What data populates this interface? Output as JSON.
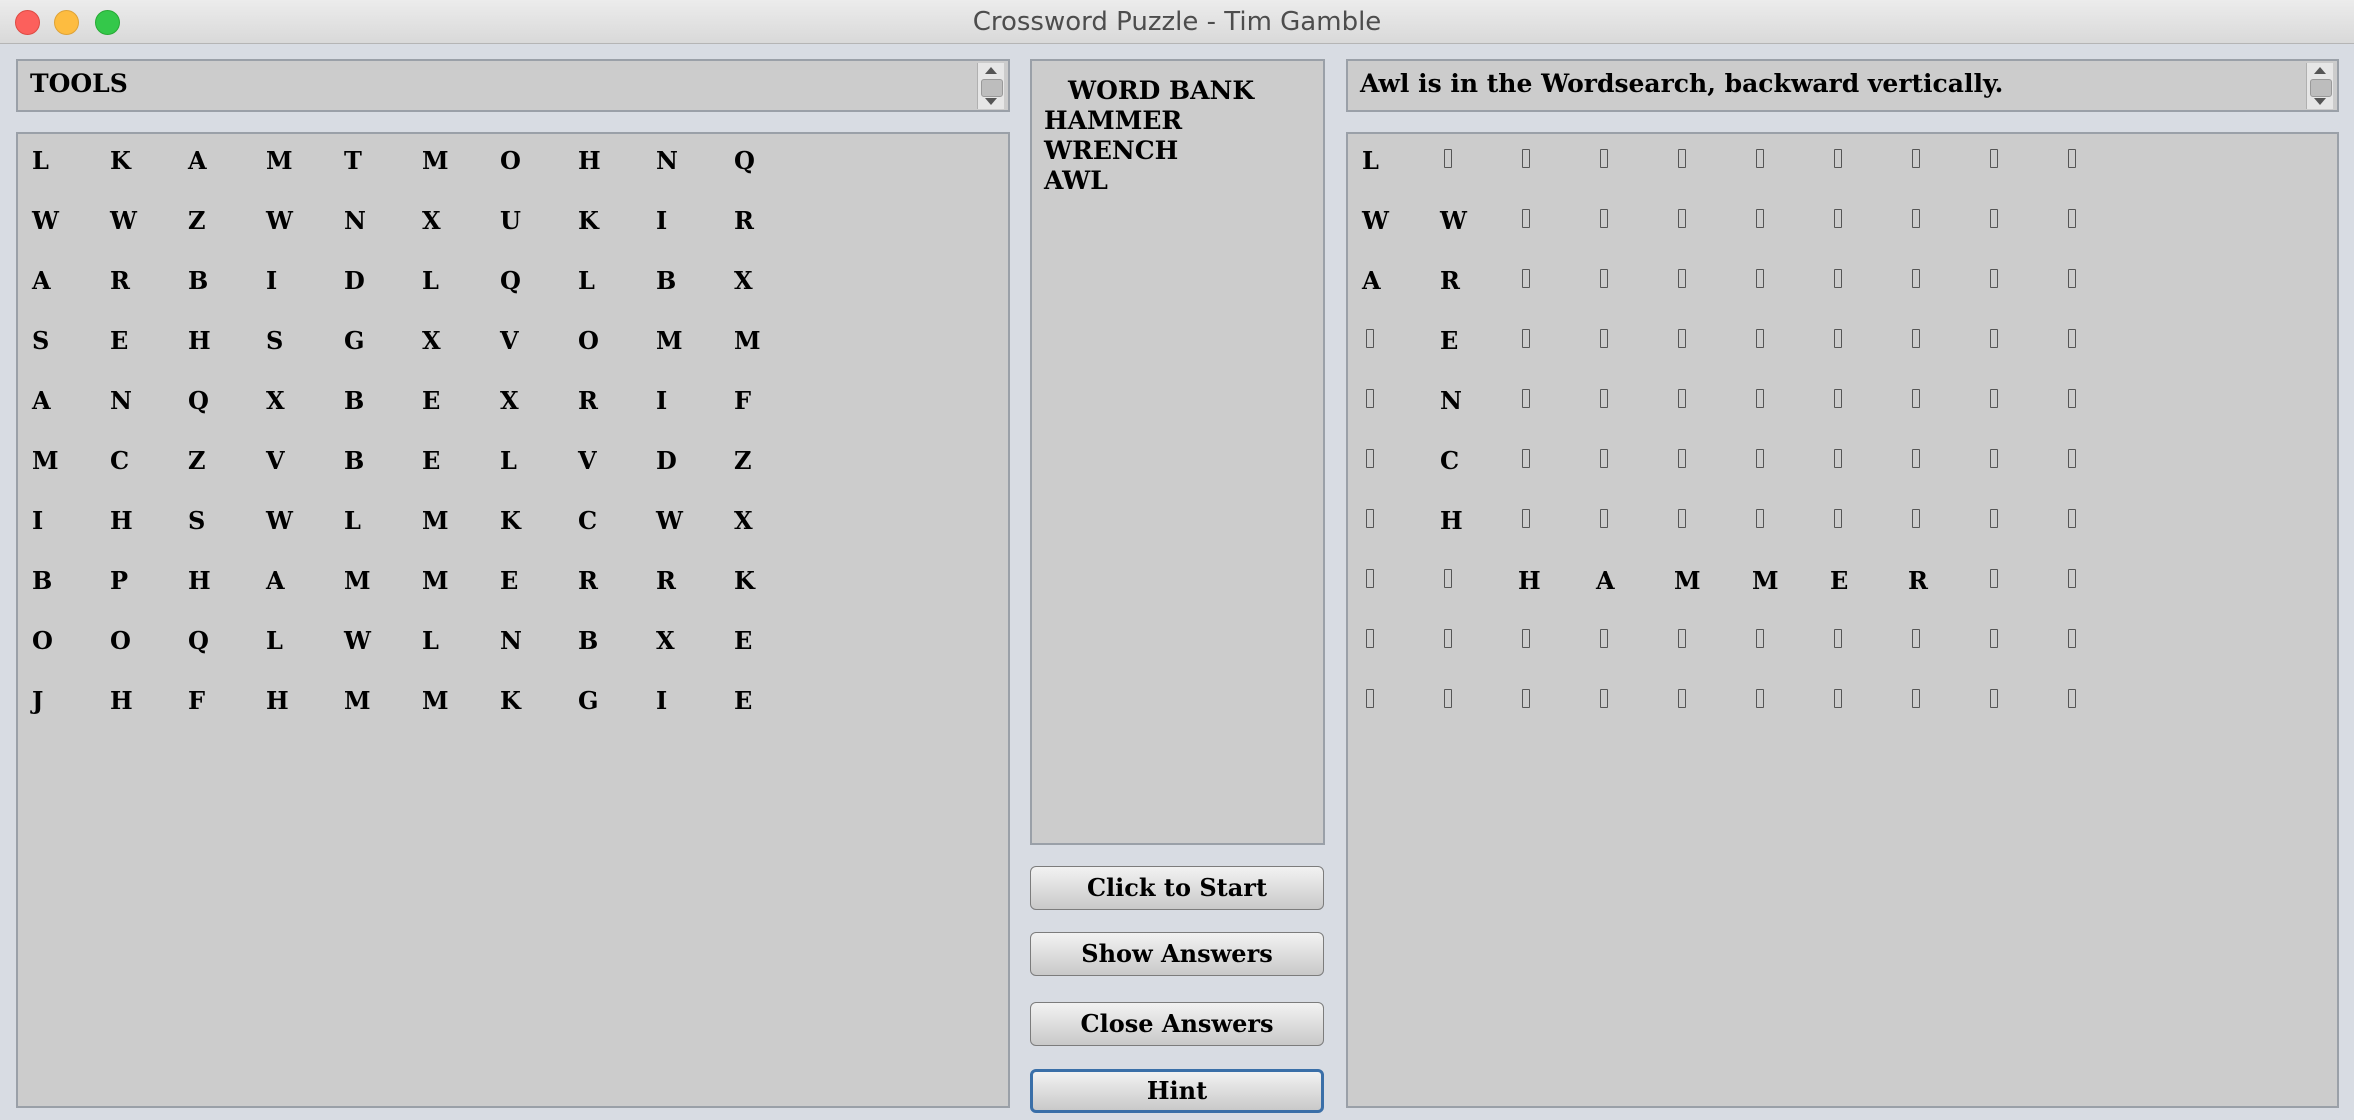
{
  "window": {
    "title": "Crossword Puzzle - Tim Gamble"
  },
  "left": {
    "category": "TOOLS",
    "grid": [
      [
        "L",
        "K",
        "A",
        "M",
        "T",
        "M",
        "O",
        "H",
        "N",
        "Q"
      ],
      [
        "W",
        "W",
        "Z",
        "W",
        "N",
        "X",
        "U",
        "K",
        "I",
        "R"
      ],
      [
        "A",
        "R",
        "B",
        "I",
        "D",
        "L",
        "Q",
        "L",
        "B",
        "X"
      ],
      [
        "S",
        "E",
        "H",
        "S",
        "G",
        "X",
        "V",
        "O",
        "M",
        "M"
      ],
      [
        "A",
        "N",
        "Q",
        "X",
        "B",
        "E",
        "X",
        "R",
        "I",
        "F"
      ],
      [
        "M",
        "C",
        "Z",
        "V",
        "B",
        "E",
        "L",
        "V",
        "D",
        "Z"
      ],
      [
        "I",
        "H",
        "S",
        "W",
        "L",
        "M",
        "K",
        "C",
        "W",
        "X"
      ],
      [
        "B",
        "P",
        "H",
        "A",
        "M",
        "M",
        "E",
        "R",
        "R",
        "K"
      ],
      [
        "O",
        "O",
        "Q",
        "L",
        "W",
        "L",
        "N",
        "B",
        "X",
        "E"
      ],
      [
        "J",
        "H",
        "F",
        "H",
        "M",
        "M",
        "K",
        "G",
        "I",
        "E"
      ]
    ]
  },
  "wordbank": {
    "title": "WORD BANK",
    "words": [
      "HAMMER",
      "WRENCH",
      "AWL"
    ]
  },
  "buttons": {
    "start": "Click to Start",
    "show": "Show Answers",
    "close": "Close Answers",
    "hint": "Hint"
  },
  "right": {
    "hint_text": "Awl is in the Wordsearch, backward vertically.",
    "grid": [
      [
        "L",
        "",
        "",
        "",
        "",
        "",
        "",
        "",
        "",
        ""
      ],
      [
        "W",
        "W",
        "",
        "",
        "",
        "",
        "",
        "",
        "",
        ""
      ],
      [
        "A",
        "R",
        "",
        "",
        "",
        "",
        "",
        "",
        "",
        ""
      ],
      [
        "",
        "E",
        "",
        "",
        "",
        "",
        "",
        "",
        "",
        ""
      ],
      [
        "",
        "N",
        "",
        "",
        "",
        "",
        "",
        "",
        "",
        ""
      ],
      [
        "",
        "C",
        "",
        "",
        "",
        "",
        "",
        "",
        "",
        ""
      ],
      [
        "",
        "H",
        "",
        "",
        "",
        "",
        "",
        "",
        "",
        ""
      ],
      [
        "",
        "",
        "H",
        "A",
        "M",
        "M",
        "E",
        "R",
        "",
        ""
      ],
      [
        "",
        "",
        "",
        "",
        "",
        "",
        "",
        "",
        "",
        ""
      ],
      [
        "",
        "",
        "",
        "",
        "",
        "",
        "",
        "",
        "",
        ""
      ]
    ]
  }
}
